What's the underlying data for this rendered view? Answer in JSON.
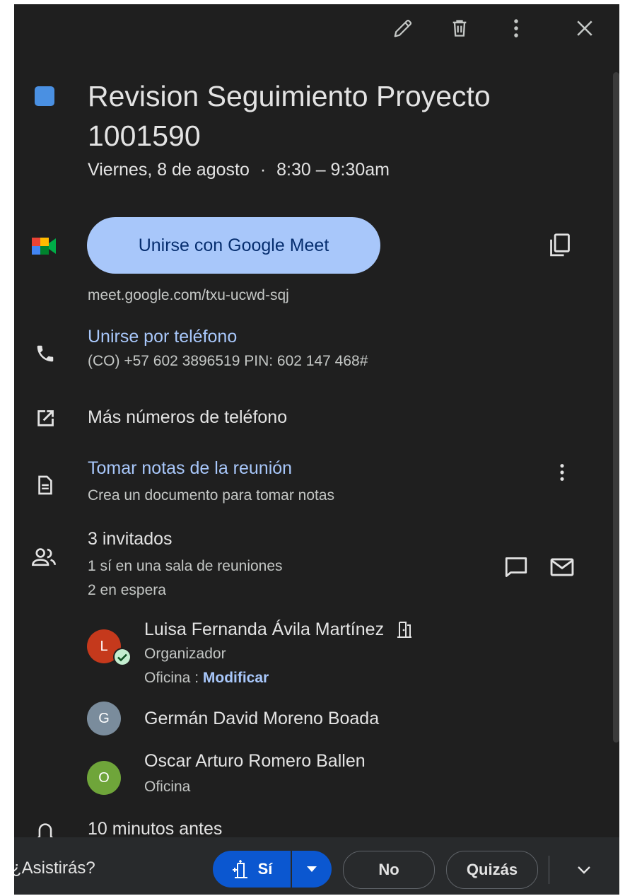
{
  "toolbar": {
    "edit_icon": "pencil-icon",
    "delete_icon": "trash-icon",
    "more_icon": "more-vert-icon",
    "close_icon": "close-icon"
  },
  "event": {
    "color": "#4a90e2",
    "title_line1": "Revision Seguimiento Proyecto",
    "title_line2": "1001590",
    "date": "Viernes, 8 de agosto",
    "separator": "·",
    "time": "8:30 – 9:30am"
  },
  "meet": {
    "button_label": "Unirse con Google Meet",
    "link": "meet.google.com/txu-ucwd-sqj"
  },
  "phone": {
    "title": "Unirse por teléfono",
    "detail": "(CO) +57 602 3896519 PIN: 602 147 468#"
  },
  "more_numbers": {
    "label": "Más números de teléfono"
  },
  "notes": {
    "title": "Tomar notas de la reunión",
    "subtitle": "Crea un documento para tomar notas"
  },
  "guests": {
    "count_label": "3 invitados",
    "yes_label": "1 sí en una sala de reuniones",
    "pending_label": "2 en espera",
    "list": [
      {
        "initial": "L",
        "name": "Luisa Fernanda Ávila Martínez",
        "role": "Organizador",
        "location_prefix": "Oficina :",
        "location_action": "Modificar",
        "avatar_color": "#c5391c"
      },
      {
        "initial": "G",
        "name": "Germán David Moreno Boada",
        "avatar_color": "#7a8c9c"
      },
      {
        "initial": "O",
        "name": "Oscar Arturo Romero Ballen",
        "location": "Oficina",
        "avatar_color": "#6fa53a"
      }
    ]
  },
  "reminder": {
    "label": "10 minutos antes"
  },
  "rsvp": {
    "question": "¿Asistirás?",
    "yes": "Sí",
    "no": "No",
    "maybe": "Quizás"
  },
  "colors": {
    "panel_bg": "#1f1f1f",
    "accent_link": "#a8c7fa",
    "meet_button_bg": "#a8c7fa",
    "yes_button_bg": "#0b57d0"
  }
}
